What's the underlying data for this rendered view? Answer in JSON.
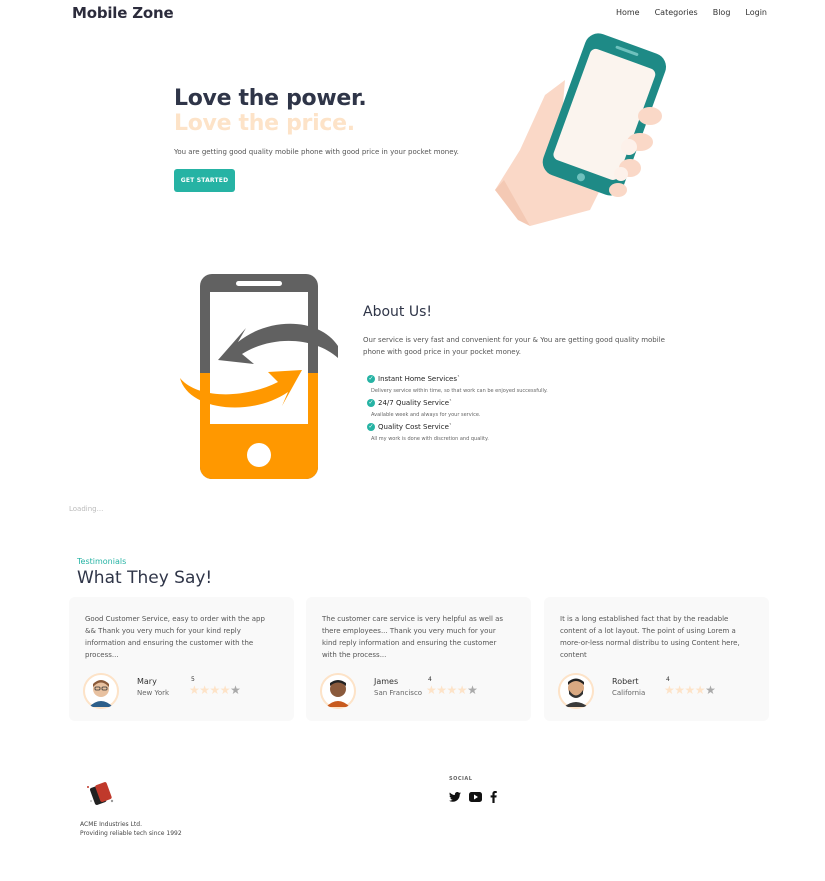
{
  "nav": {
    "brand": "Mobile Zone",
    "links": [
      "Home",
      "Categories",
      "Blog",
      "Login"
    ]
  },
  "hero": {
    "title_line1": "Love the power.",
    "title_line2": "Love the price.",
    "subtitle": "You are getting good quality mobile phone with good price in your pocket money.",
    "cta_label": "GET STARTED"
  },
  "about": {
    "title": "About Us!",
    "text": "Our service is very fast and convenient for your & You are getting good quality mobile phone with good price in your pocket money.",
    "features": [
      {
        "title": "Instant Home Services`",
        "desc": "Delivery service within time, so that work can be enjoyed successfully."
      },
      {
        "title": "24/7 Quality Service`",
        "desc": "Available week and always for your service."
      },
      {
        "title": "Quality Cost Service`",
        "desc": "All my work is done with discretion and quality."
      }
    ]
  },
  "loading_text": "Loading...",
  "testimonials": {
    "label": "Testimonials",
    "title": "What They Say!",
    "items": [
      {
        "text": "Good Customer Service, easy to order with the app && Thank you very much for your kind reply information and ensuring the customer with the process...",
        "name": "Mary",
        "city": "New York",
        "rating": "5",
        "stars_filled": 4
      },
      {
        "text": "The customer care service is very helpful as well as there employees... Thank you very much for your kind reply information and ensuring the customer with the process...",
        "name": "James",
        "city": "San Francisco",
        "rating": "4",
        "stars_filled": 4
      },
      {
        "text": "It is a long established fact that by the readable content of a lot layout. The point of using Lorem a more-or-less normal distribu to using Content here, content",
        "name": "Robert",
        "city": "California",
        "rating": "4",
        "stars_filled": 4
      }
    ]
  },
  "footer": {
    "company": "ACME Industries Ltd.",
    "tagline": "Providing reliable tech since 1992",
    "social_label": "SOCIAL",
    "social_icons": [
      "twitter-icon",
      "youtube-icon",
      "facebook-icon"
    ]
  },
  "colors": {
    "accent": "#26b3a4",
    "peach": "#fde3c8",
    "heading": "#2f3548",
    "phone_orange": "#ff9800",
    "phone_gray": "#616161"
  }
}
